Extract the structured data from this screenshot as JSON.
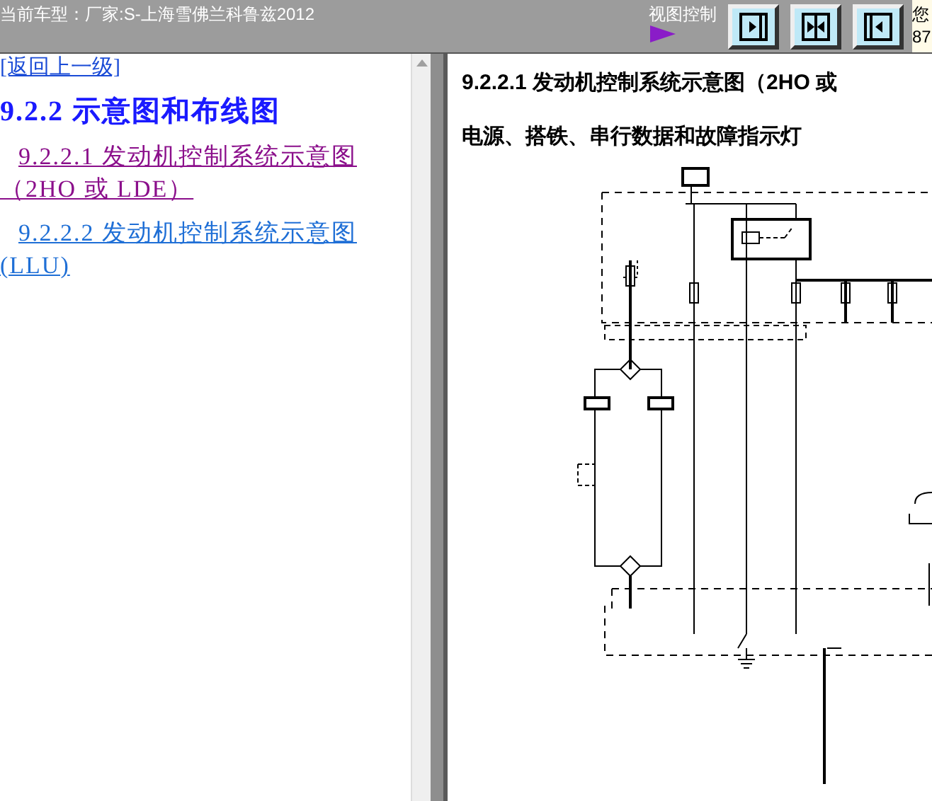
{
  "header": {
    "car_model": "当前车型：厂家:S-上海雪佛兰科鲁兹2012",
    "view_control_label": "视图控制",
    "view_buttons": [
      {
        "kind": "left"
      },
      {
        "kind": "split"
      },
      {
        "kind": "right"
      }
    ],
    "side_text": [
      "您",
      "87"
    ]
  },
  "nav": {
    "back_link": "[返回上一级]",
    "section_title": "9.2.2 示意图和布线图",
    "links": [
      {
        "text": "9.2.2.1 发动机控制系统示意图（2HO 或 LDE）",
        "visited": true
      },
      {
        "text": "9.2.2.2 发动机控制系统示意图 (LLU)",
        "visited": false
      }
    ]
  },
  "content": {
    "title": "9.2.2.1 发动机控制系统示意图（2HO 或",
    "subtitle": "电源、搭铁、串行数据和故障指示灯"
  }
}
